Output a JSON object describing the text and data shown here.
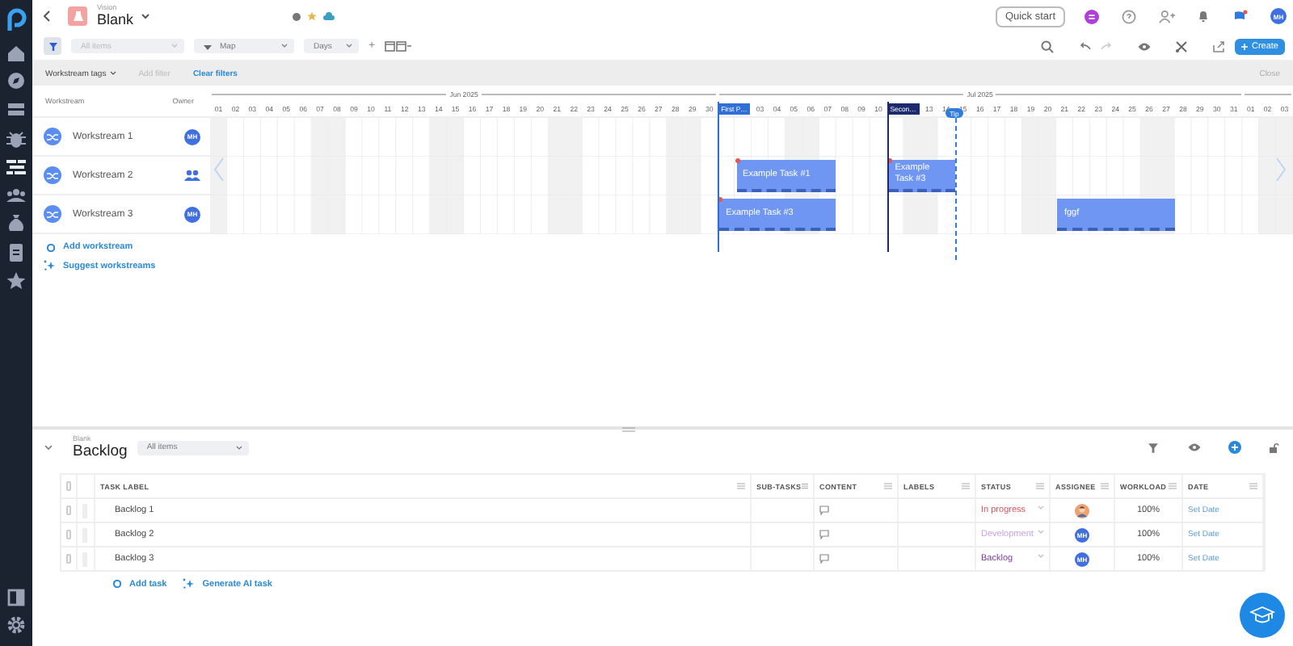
{
  "sidebar": {
    "items": [
      {
        "selected": false
      },
      {
        "selected": false
      },
      {
        "selected": false
      },
      {
        "selected": false
      },
      {
        "selected": true
      },
      {
        "selected": false
      },
      {
        "selected": false
      },
      {
        "selected": false
      },
      {
        "selected": false
      }
    ],
    "bottom": [
      {
        "selected": false
      },
      {
        "selected": false
      }
    ]
  },
  "header": {
    "caption": "Vision",
    "title": "Blank",
    "quick_start": "Quick start",
    "user_initials": "MH"
  },
  "toolbar": {
    "item_filter": "All items",
    "view": "Map",
    "scale": "Days",
    "zoom": "+",
    "create": "Create"
  },
  "filter_bar": {
    "tag_filter": "Workstream tags",
    "add_filter": {
      "label": "Add filter",
      "disabled": true
    },
    "clear": "Clear filters",
    "close": "Close"
  },
  "gantt": {
    "columns": [
      "Workstream",
      "Owner"
    ],
    "months": [
      {
        "label": "Jun 2025"
      },
      {
        "label": "Jul 2025"
      }
    ],
    "days": [
      "01",
      "02",
      "03",
      "04",
      "05",
      "06",
      "07",
      "08",
      "09",
      "10",
      "11",
      "12",
      "13",
      "14",
      "15",
      "16",
      "17",
      "18",
      "19",
      "20",
      "21",
      "22",
      "23",
      "24",
      "25",
      "26",
      "27",
      "28",
      "29",
      "30",
      "03",
      "04",
      "05",
      "06",
      "07",
      "08",
      "09",
      "10",
      "13",
      "14",
      "15",
      "16",
      "17",
      "18",
      "19",
      "20",
      "21",
      "22",
      "23",
      "24",
      "25",
      "26",
      "27",
      "28",
      "29",
      "30",
      "31",
      "01",
      "02",
      "03"
    ],
    "milestones": [
      {
        "label": "First P…",
        "kind": "milestone",
        "color": "#2f6fd6"
      },
      {
        "label": "Secon…",
        "kind": "milestone",
        "color": "#1e2a6e"
      },
      {
        "label": "Tip",
        "kind": "tip",
        "color": "#2f7be0"
      }
    ],
    "workstreams": [
      {
        "name": "Workstream 1",
        "owner": {
          "kind": "avatar",
          "initials": "MH"
        }
      },
      {
        "name": "Workstream 2",
        "owner": {
          "kind": "group"
        },
        "tasks": [
          {
            "label": "Example Task #1",
            "marker": true
          },
          {
            "label": "Example Task #3",
            "marker": true
          }
        ]
      },
      {
        "name": "Workstream 3",
        "owner": {
          "kind": "avatar",
          "initials": "MH"
        },
        "tasks": [
          {
            "label": "Example Task #3",
            "marker": true
          },
          {
            "label": "fggf",
            "marker": false
          }
        ]
      }
    ],
    "add": "Add workstream",
    "suggest": "Suggest workstreams"
  },
  "backlog": {
    "caption": "Blank",
    "title": "Backlog",
    "filter": "All items",
    "select_all": {
      "checked": false
    },
    "columns": [
      "TASK LABEL",
      "SUB-TASKS",
      "CONTENT",
      "LABELS",
      "STATUS",
      "ASSIGNEE",
      "WORKLOAD",
      "DATE"
    ],
    "rows": [
      {
        "checked": false,
        "label": "Backlog 1",
        "status": {
          "text": "In progress",
          "color": "#e0505a"
        },
        "workload": "100%",
        "date": "Set Date"
      },
      {
        "checked": false,
        "label": "Backlog 2",
        "status": {
          "text": "Development",
          "color": "#c6a4e6"
        },
        "assignee": {
          "kind": "initials",
          "initials": "MH"
        },
        "workload": "100%",
        "date": "Set Date"
      },
      {
        "checked": false,
        "label": "Backlog 3",
        "status": {
          "text": "Backlog",
          "color": "#7a3b9c"
        },
        "assignee": {
          "kind": "initials",
          "initials": "MH"
        },
        "workload": "100%",
        "date": "Set Date"
      }
    ],
    "add_task": "Add task",
    "generate": "Generate AI task"
  }
}
